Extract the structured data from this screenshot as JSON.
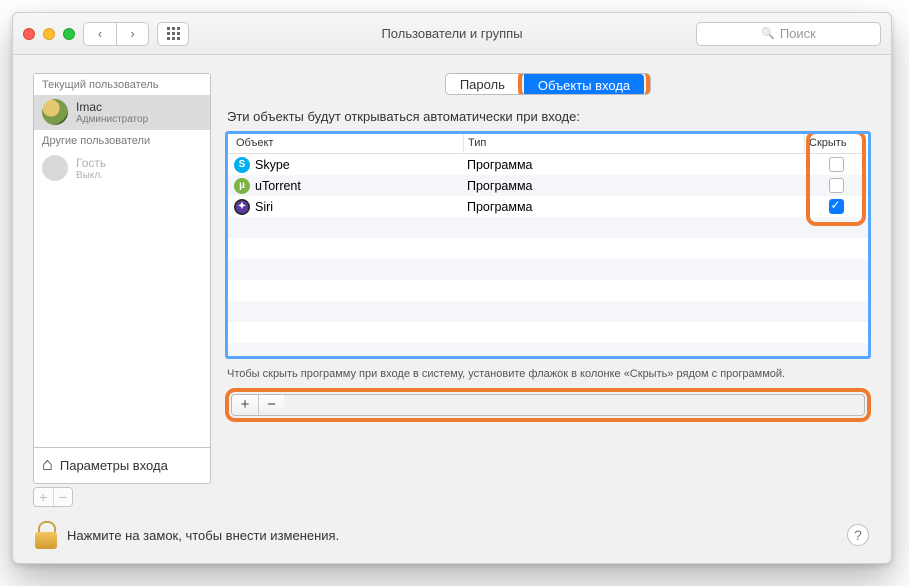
{
  "window": {
    "title": "Пользователи и группы",
    "search_placeholder": "Поиск"
  },
  "sidebar": {
    "current_header": "Текущий пользователь",
    "other_header": "Другие пользователи",
    "current_user": {
      "name": "Imac",
      "role": "Администратор"
    },
    "guest": {
      "name": "Гость",
      "role": "Выкл."
    },
    "login_options": "Параметры входа"
  },
  "tabs": {
    "password": "Пароль",
    "login_items": "Объекты входа"
  },
  "main": {
    "intro": "Эти объекты будут открываться автоматически при входе:",
    "columns": {
      "object": "Объект",
      "type": "Тип",
      "hide": "Скрыть"
    },
    "rows": [
      {
        "icon": "skype",
        "name": "Skype",
        "type": "Программа",
        "hidden": false
      },
      {
        "icon": "utor",
        "name": "uTorrent",
        "type": "Программа",
        "hidden": false
      },
      {
        "icon": "siri",
        "name": "Siri",
        "type": "Программа",
        "hidden": true
      }
    ],
    "hint": "Чтобы скрыть программу при входе в систему, установите флажок в колонке «Скрыть» рядом с программой."
  },
  "footer": {
    "lock_text": "Нажмите на замок, чтобы внести изменения."
  },
  "glyphs": {
    "back": "‹",
    "fwd": "›",
    "plus": "+",
    "minus": "−",
    "help": "?",
    "search": "🔍",
    "home": "⌂"
  }
}
